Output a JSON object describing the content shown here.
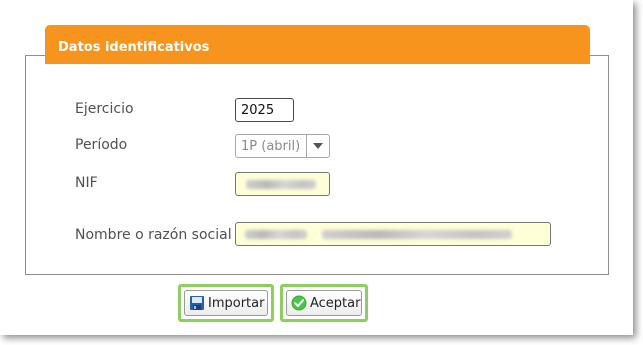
{
  "section": {
    "title": "Datos identificativos"
  },
  "fields": {
    "ejercicio": {
      "label": "Ejercicio",
      "value": "2025"
    },
    "periodo": {
      "label": "Período",
      "value": "1P (abril)"
    },
    "nif": {
      "label": "NIF"
    },
    "nombre": {
      "label": "Nombre o razón social"
    }
  },
  "buttons": {
    "importar": {
      "label": "Importar",
      "icon": "import-disk-icon"
    },
    "aceptar": {
      "label": "Aceptar",
      "icon": "check-circle-icon"
    }
  },
  "colors": {
    "header": "#f7941d",
    "focus_ring": "#8ccf5d",
    "field_highlight": "#fefed7"
  }
}
